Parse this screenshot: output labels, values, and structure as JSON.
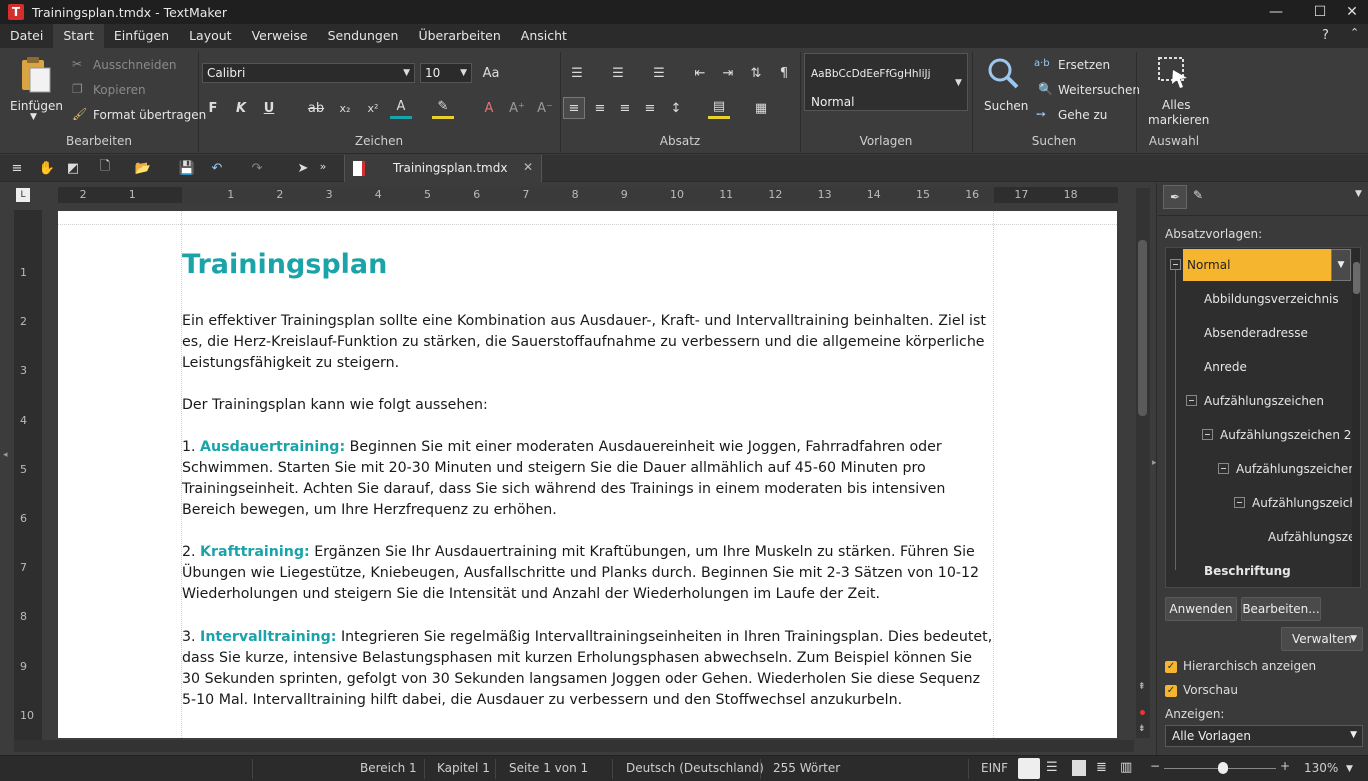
{
  "window": {
    "title": "Trainingsplan.tmdx - TextMaker",
    "app_letter": "T",
    "help": "?"
  },
  "menu": [
    "Datei",
    "Start",
    "Einfügen",
    "Layout",
    "Verweise",
    "Sendungen",
    "Überarbeiten",
    "Ansicht"
  ],
  "ribbon": {
    "edit": {
      "paste": "Einfügen",
      "cut": "Ausschneiden",
      "copy": "Kopieren",
      "format_painter": "Format übertragen",
      "label": "Bearbeiten"
    },
    "font": {
      "name": "Calibri",
      "size": "10",
      "label": "Zeichen"
    },
    "paragraph": {
      "label": "Absatz"
    },
    "styles": {
      "preview": "AaBbCcDdEeFfGgHhIiJj",
      "current": "Normal",
      "label": "Vorlagen"
    },
    "search": {
      "search": "Suchen",
      "replace": "Ersetzen",
      "find_next": "Weitersuchen",
      "goto": "Gehe zu",
      "label": "Suchen"
    },
    "select": {
      "select_all_1": "Alles",
      "select_all_2": "markieren",
      "label": "Auswahl"
    }
  },
  "doc_tab": "Trainingsplan.tmdx",
  "ruler": {
    "h": [
      "2",
      "1",
      "1",
      "2",
      "3",
      "4",
      "5",
      "6",
      "7",
      "8",
      "9",
      "10",
      "11",
      "12",
      "13",
      "14",
      "15",
      "16",
      "17",
      "18"
    ],
    "v": [
      "1",
      "2",
      "3",
      "4",
      "5",
      "6",
      "7",
      "8",
      "9",
      "10"
    ]
  },
  "document": {
    "title": "Trainingsplan",
    "p1": "Ein effektiver Trainingsplan sollte eine Kombination aus Ausdauer-, Kraft- und Intervalltraining beinhalten. Ziel ist es, die Herz-Kreislauf-Funktion zu stärken, die Sauerstoffaufnahme zu verbessern und die allgemeine körperliche Leistungsfähigkeit zu steigern.",
    "p2": "Der Trainingsplan kann wie folgt aussehen:",
    "items": [
      {
        "num": "1. ",
        "head": "Ausdauertraining:",
        "text": " Beginnen Sie mit einer moderaten Ausdauereinheit wie Joggen, Fahrradfahren oder Schwimmen. Starten Sie mit 20-30 Minuten und steigern Sie die Dauer allmählich auf 45-60 Minuten pro Trainingseinheit. Achten Sie darauf, dass Sie sich während des Trainings in einem moderaten bis intensiven Bereich bewegen, um Ihre Herzfrequenz zu erhöhen."
      },
      {
        "num": "2. ",
        "head": "Krafttraining:",
        "text": " Ergänzen Sie Ihr Ausdauertraining mit Kraftübungen, um Ihre Muskeln zu stärken. Führen Sie Übungen wie Liegestütze, Kniebeugen, Ausfallschritte und Planks durch. Beginnen Sie mit 2-3 Sätzen von 10-12 Wiederholungen und steigern Sie die Intensität und Anzahl der Wiederholungen im Laufe der Zeit."
      },
      {
        "num": "3. ",
        "head": "Intervalltraining:",
        "text": " Integrieren Sie regelmäßig Intervalltrainingseinheiten in Ihren Trainingsplan. Dies bedeutet, dass Sie kurze, intensive Belastungsphasen mit kurzen Erholungsphasen abwechseln. Zum Beispiel können Sie 30 Sekunden sprinten, gefolgt von 30 Sekunden langsamen Joggen oder Gehen. Wiederholen Sie diese Sequenz 5-10 Mal. Intervalltraining hilft dabei, die Ausdauer zu verbessern und den Stoffwechsel anzukurbeln."
      }
    ]
  },
  "sidebar": {
    "heading": "Absatzvorlagen:",
    "styles": [
      "Normal",
      "Abbildungsverzeichnis",
      "Absenderadresse",
      "Anrede",
      "Aufzählungszeichen",
      "Aufzählungszeichen 2",
      "Aufzählungszeichen",
      "Aufzählungszeich",
      "Aufzählungsze",
      "Beschriftung"
    ],
    "apply": "Anwenden",
    "edit": "Bearbeiten...",
    "manage": "Verwalten",
    "hierarchical": "Hierarchisch anzeigen",
    "preview": "Vorschau",
    "show_label": "Anzeigen:",
    "show_value": "Alle Vorlagen"
  },
  "status": {
    "section": "Bereich 1",
    "chapter": "Kapitel 1",
    "page": "Seite 1 von 1",
    "language": "Deutsch (Deutschland)",
    "words": "255 Wörter",
    "mode": "EINF",
    "zoom": "130%",
    "minus": "−",
    "plus": "+"
  },
  "colors": {
    "accent": "#1aa3a8",
    "selected_style": "#f5b52e"
  }
}
